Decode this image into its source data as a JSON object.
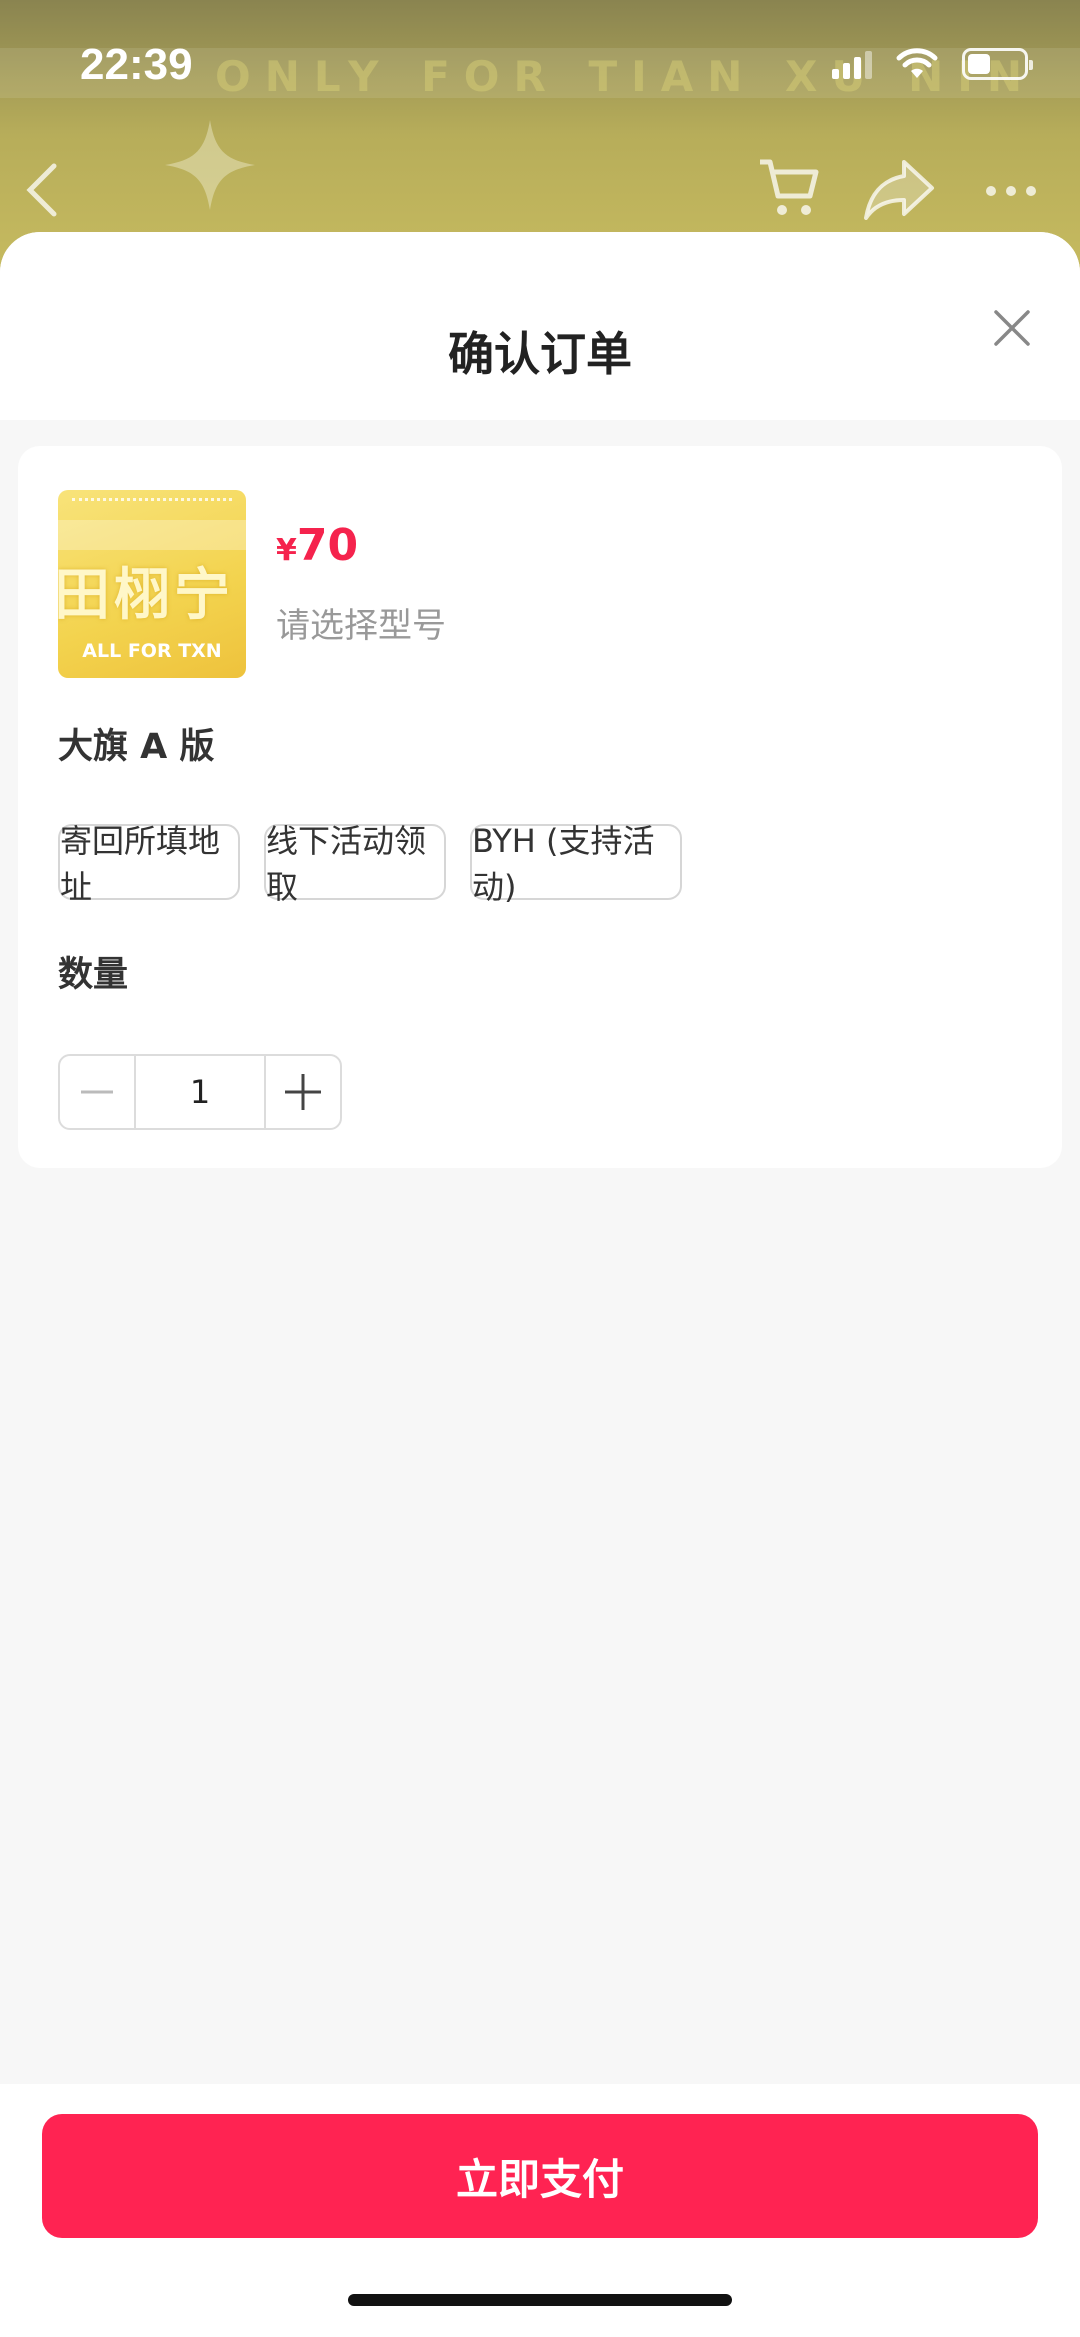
{
  "status_bar": {
    "time": "22:39"
  },
  "background": {
    "banner_text": "ONLY FOR TIAN XU NIN"
  },
  "sheet": {
    "title": "确认订单",
    "product": {
      "thumb_main_text": "田栩宁",
      "thumb_sub_text": "ALL FOR TXN",
      "price_currency": "¥",
      "price_amount": "70",
      "hint": "请选择型号"
    },
    "variant_section": {
      "label": "大旗 A 版",
      "options": [
        "寄回所填地址",
        "线下活动领取",
        "BYH (支持活动)"
      ]
    },
    "quantity_section": {
      "label": "数量",
      "value": "1"
    },
    "pay_button": "立即支付"
  },
  "colors": {
    "accent": "#ff2352",
    "price": "#f5234d"
  },
  "icons": [
    "back-icon",
    "cart-icon",
    "share-icon",
    "more-icon",
    "close-icon",
    "minus-icon",
    "plus-icon",
    "wifi-icon",
    "battery-icon",
    "signal-icon"
  ]
}
